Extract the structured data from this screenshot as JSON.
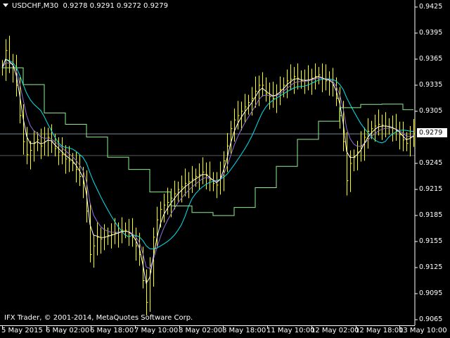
{
  "header": {
    "symbol": "USDCHF,M30",
    "ohlc": "0.9278 0.9291 0.9272 0.9279"
  },
  "copyright": "IFX Trader, © 2001-2014, MetaQuotes Software Corp.",
  "price_axis": {
    "labels": [
      "0.9425",
      "0.9395",
      "0.9365",
      "0.9335",
      "0.9305",
      "0.9245",
      "0.9215",
      "0.9185",
      "0.9155",
      "0.9125",
      "0.9095",
      "0.9065"
    ],
    "current_price": "0.9279"
  },
  "time_axis": {
    "labels": [
      "5 May 2015",
      "6 May 02:00",
      "6 May 18:00",
      "7 May 10:00",
      "8 May 02:00",
      "8 May 18:00",
      "11 May 10:00",
      "12 May 02:00",
      "12 May 18:00",
      "13 May 10:00"
    ]
  },
  "colors": {
    "bars": "#FFFF00",
    "ma_fast": "#FFFFFF",
    "ma_mid": "#9370DB",
    "ma_slow": "#00E5EE",
    "ma_htf": "#90EE90",
    "price_line": "#778899",
    "grid_line": "#5A5A5A"
  },
  "chart_data": {
    "type": "ohlc",
    "symbol": "USDCHF",
    "timeframe": "M30",
    "ylim": [
      0.9065,
      0.9425
    ],
    "extra_level": 0.9254,
    "closes": [
      0.9355,
      0.9375,
      0.936,
      0.9355,
      0.9335,
      0.93,
      0.927,
      0.9255,
      0.926,
      0.9268,
      0.9272,
      0.9265,
      0.927,
      0.9275,
      0.927,
      0.9262,
      0.9258,
      0.9255,
      0.925,
      0.9248,
      0.9245,
      0.9238,
      0.923,
      0.9222,
      0.919,
      0.914,
      0.915,
      0.916,
      0.9158,
      0.916,
      0.9162,
      0.9163,
      0.9165,
      0.9166,
      0.9168,
      0.9168,
      0.9165,
      0.916,
      0.915,
      0.914,
      0.911,
      0.9085,
      0.912,
      0.916,
      0.918,
      0.9192,
      0.9197,
      0.92,
      0.9205,
      0.921,
      0.9215,
      0.9218,
      0.9222,
      0.9224,
      0.9227,
      0.923,
      0.9232,
      0.9235,
      0.9232,
      0.9226,
      0.9222,
      0.922,
      0.923,
      0.9248,
      0.9265,
      0.9285,
      0.9295,
      0.93,
      0.9305,
      0.931,
      0.9315,
      0.932,
      0.9328,
      0.9335,
      0.9335,
      0.9325,
      0.9322,
      0.932,
      0.9325,
      0.933,
      0.9335,
      0.934,
      0.9342,
      0.9345,
      0.9343,
      0.934,
      0.934,
      0.9341,
      0.9343,
      0.9345,
      0.9347,
      0.9342,
      0.934,
      0.934,
      0.9335,
      0.932,
      0.93,
      0.927,
      0.9225,
      0.9245,
      0.9252,
      0.9258,
      0.9265,
      0.9275,
      0.9282,
      0.9285,
      0.9288,
      0.929,
      0.9289,
      0.9288,
      0.9287,
      0.9285,
      0.9282,
      0.9278,
      0.9272,
      0.9268,
      0.9275,
      0.9279
    ]
  }
}
